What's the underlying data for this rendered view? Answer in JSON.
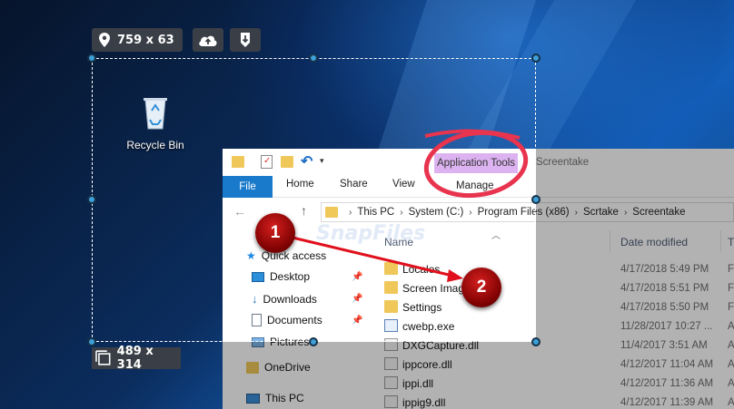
{
  "toolbar": {
    "size_label": "759 x 63",
    "location_icon": "map-pin-icon",
    "upload_icon": "cloud-upload-icon",
    "save_icon": "save-icon"
  },
  "desktop": {
    "recycle_bin_label": "Recycle Bin"
  },
  "ribbon": {
    "context_group": "Application Tools",
    "tabs": [
      "File",
      "Home",
      "Share",
      "View",
      "Manage"
    ],
    "window_title": "Screentake"
  },
  "address": {
    "crumbs": [
      "This PC",
      "System (C:)",
      "Program Files (x86)",
      "Scrtake",
      "Screentake"
    ]
  },
  "nav": {
    "items": [
      "Quick access",
      "Desktop",
      "Downloads",
      "Documents",
      "Pictures",
      "OneDrive",
      "This PC"
    ]
  },
  "columns": {
    "name": "Name",
    "date": "Date modified",
    "type": "T"
  },
  "files": [
    {
      "name": "Locales",
      "date": "4/17/2018 5:49 PM",
      "type": "F",
      "kind": "folder"
    },
    {
      "name": "Screen Imag",
      "date": "4/17/2018 5:51 PM",
      "type": "F",
      "kind": "folder"
    },
    {
      "name": "Settings",
      "date": "4/17/2018 5:50 PM",
      "type": "F",
      "kind": "folder"
    },
    {
      "name": "cwebp.exe",
      "date": "11/28/2017 10:27 ...",
      "type": "A",
      "kind": "app"
    },
    {
      "name": "DXGCapture.dll",
      "date": "11/4/2017 3:51 AM",
      "type": "A",
      "kind": "dll"
    },
    {
      "name": "ippcore.dll",
      "date": "4/12/2017 11:04 AM",
      "type": "A",
      "kind": "dll"
    },
    {
      "name": "ippi.dll",
      "date": "4/12/2017 11:36 AM",
      "type": "A",
      "kind": "dll"
    },
    {
      "name": "ippig9.dll",
      "date": "4/12/2017 11:39 AM",
      "type": "A",
      "kind": "dll"
    }
  ],
  "selection": {
    "size_label": "489 x 314"
  },
  "annotations": {
    "marker_1": "1",
    "marker_2": "2",
    "circle_color": "#e8344e",
    "arrow_color": "#e0101c"
  },
  "watermark": "SnapFiles",
  "colors": {
    "file_tab": "#1979ca",
    "app_tools_highlight": "#dcb3f0",
    "handle": "#3ea0d8"
  }
}
